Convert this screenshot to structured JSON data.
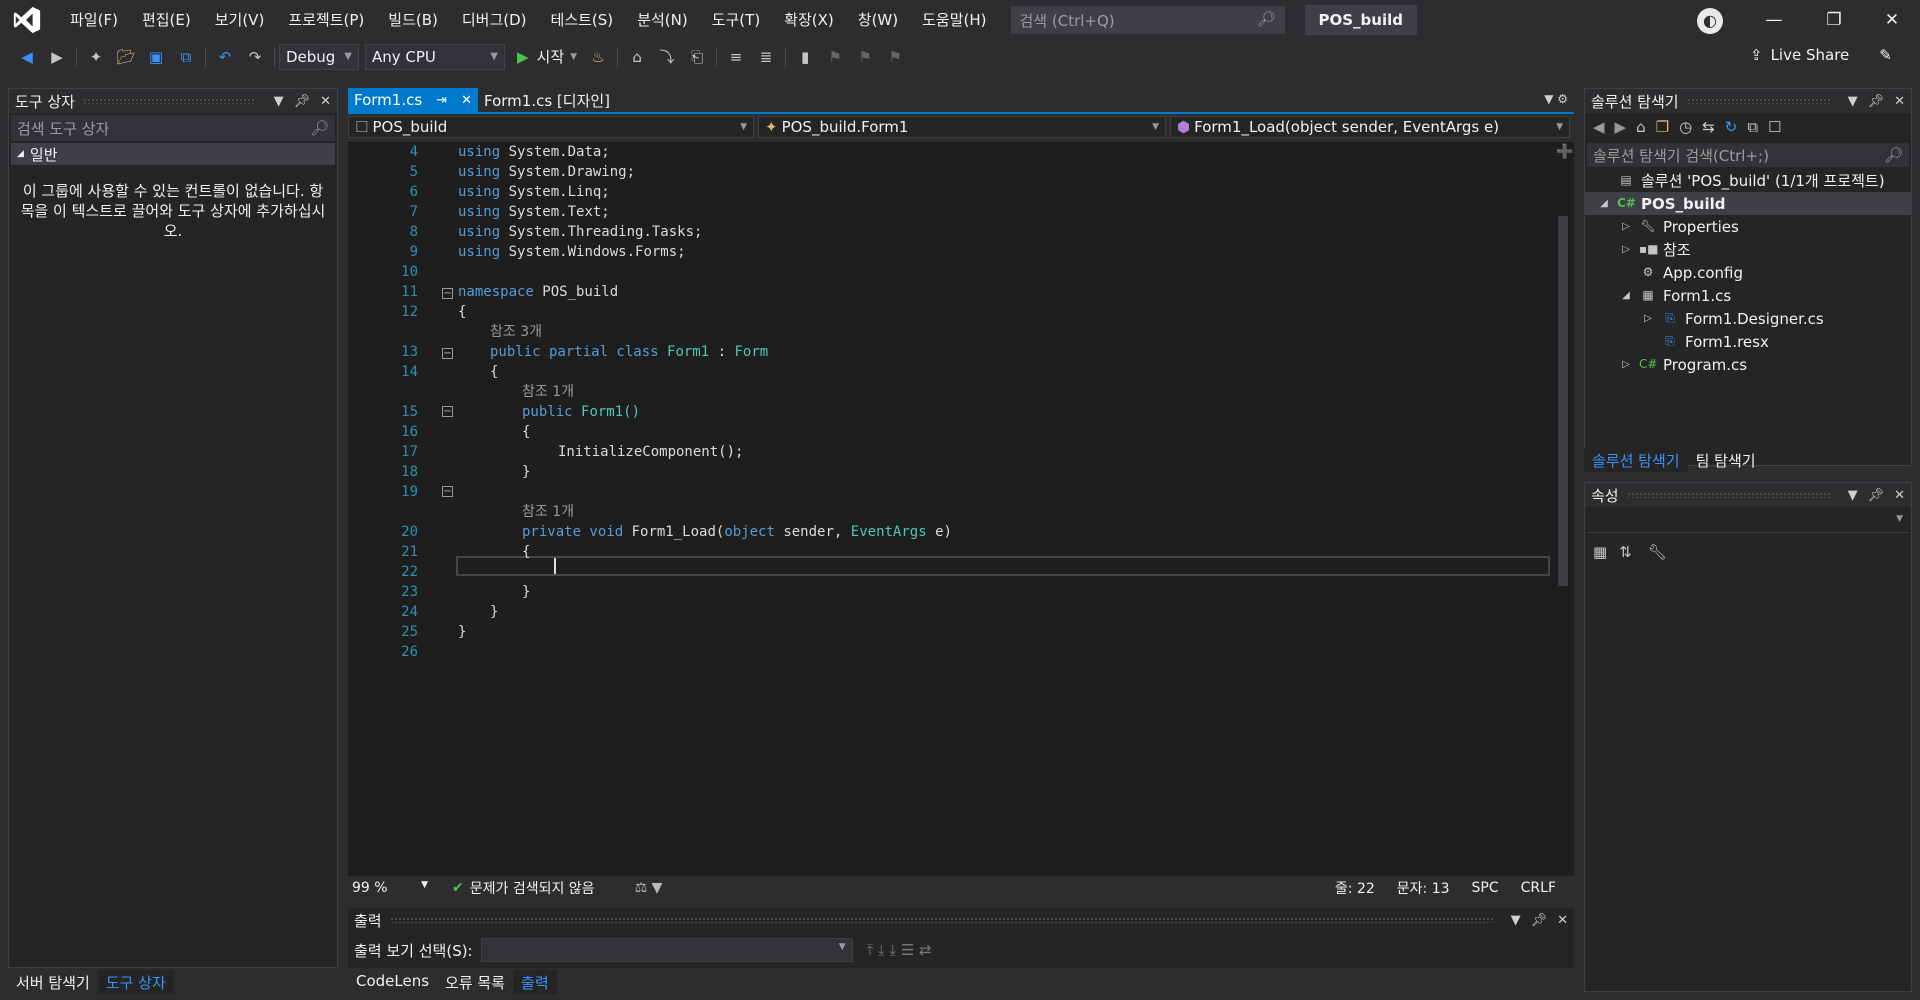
{
  "menu": [
    "파일(F)",
    "편집(E)",
    "보기(V)",
    "프로젝트(P)",
    "빌드(B)",
    "디버그(D)",
    "테스트(S)",
    "분석(N)",
    "도구(T)",
    "확장(X)",
    "창(W)",
    "도움말(H)"
  ],
  "search": {
    "placeholder": "검색 (Ctrl+Q)"
  },
  "solution_name": "POS_build",
  "toolbar": {
    "config": "Debug",
    "platform": "Any CPU",
    "start": "시작",
    "live_share": "Live Share"
  },
  "toolbox": {
    "title": "도구 상자",
    "search_placeholder": "검색 도구 상자",
    "group": "일반",
    "empty_text": "이 그룹에 사용할 수 있는 컨트롤이 없습니다. 항목을 이 텍스트로 끌어와 도구 상자에 추가하십시오.",
    "bottom_tabs": [
      "서버 탐색기",
      "도구 상자"
    ]
  },
  "editor": {
    "tabs": [
      "Form1.cs",
      "Form1.cs [디자인]"
    ],
    "nav": [
      "POS_build",
      "POS_build.Form1",
      "Form1_Load(object sender, EventArgs e)"
    ],
    "line_numbers": [
      "4",
      "5",
      "6",
      "7",
      "8",
      "9",
      "10",
      "11",
      "12",
      "",
      "13",
      "14",
      "",
      "15",
      "16",
      "17",
      "18",
      "19",
      "",
      "20",
      "21",
      "22",
      "23",
      "24",
      "25",
      "26"
    ],
    "code": {
      "l4": [
        "using",
        " System.Data;"
      ],
      "l5": [
        "using",
        " System.Drawing;"
      ],
      "l6": [
        "using",
        " System.Linq;"
      ],
      "l7": [
        "using",
        " System.Text;"
      ],
      "l8": [
        "using",
        " System.Threading.Tasks;"
      ],
      "l9": [
        "using",
        " System.Windows.Forms;"
      ],
      "l11": [
        "namespace",
        " POS_build"
      ],
      "ref3": "참조 3개",
      "l13": [
        "public partial class",
        "Form1",
        ":",
        "Form"
      ],
      "ref1a": "참조 1개",
      "l15": [
        "public",
        "Form1()"
      ],
      "l17": "InitializeComponent();",
      "ref1b": "참조 1개",
      "l20": [
        "private void",
        "Form1_Load(",
        "object",
        "sender,",
        "EventArgs",
        "e)"
      ],
      "open": "{",
      "close": "}"
    },
    "zoom": "99 %",
    "issues": "문제가 검색되지 않음",
    "line": "줄: 22",
    "col": "문자: 13",
    "spc": "SPC",
    "eol": "CRLF"
  },
  "output": {
    "title": "출력",
    "select_label": "출력 보기 선택(S):",
    "bottom_tabs": [
      "CodeLens",
      "오류 목록",
      "출력"
    ]
  },
  "solution_explorer": {
    "title": "솔루션 탐색기",
    "search_placeholder": "솔루션 탐색기 검색(Ctrl+;)",
    "items": [
      "솔루션 'POS_build' (1/1개 프로젝트)",
      "POS_build",
      "Properties",
      "참조",
      "App.config",
      "Form1.cs",
      "Form1.Designer.cs",
      "Form1.resx",
      "Program.cs"
    ],
    "tabs": [
      "솔루션 탐색기",
      "팀 탐색기"
    ]
  },
  "properties": {
    "title": "속성"
  }
}
